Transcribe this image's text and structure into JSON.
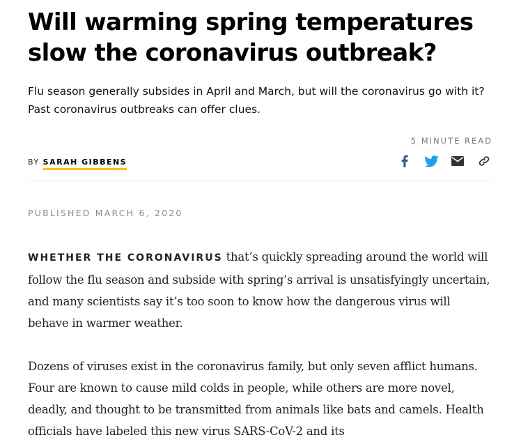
{
  "article": {
    "headline": "Will warming spring temperatures slow the coronavirus outbreak?",
    "dek": "Flu season generally subsides in April and March, but will the coronavirus go with it? Past coronavirus outbreaks can offer clues.",
    "read_time": "5 MINUTE READ",
    "byline_prefix": "BY",
    "author": "SARAH GIBBENS",
    "published": "PUBLISHED MARCH 6, 2020",
    "paragraphs": [
      {
        "lead_in": "WHETHER THE CORONAVIRUS",
        "text": " that’s quickly spreading around the world will follow the flu season and subside with spring’s arrival is unsatisfyingly uncertain, and many scientists say it’s too soon to know how the dangerous virus will behave in warmer weather."
      },
      {
        "text": "Dozens of viruses exist in the coronavirus family, but only seven afflict humans. Four are known to cause mild colds in people, while others are more novel, deadly, and thought to be transmitted from animals like bats and camels. Health officials have labeled this new virus SARS-CoV-2 and its"
      }
    ]
  },
  "share": {
    "icons": [
      "facebook-icon",
      "twitter-icon",
      "email-icon",
      "link-icon"
    ],
    "facebook_color": "#3b5998",
    "twitter_color": "#1da1f2",
    "neutral_color": "#333333"
  },
  "colors": {
    "author_underline": "#fcc000"
  }
}
